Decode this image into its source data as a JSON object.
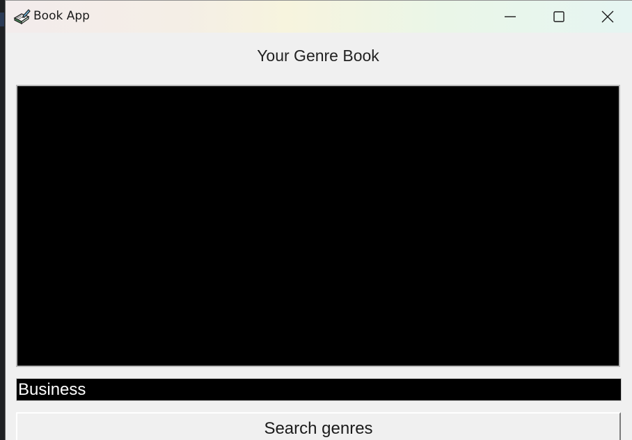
{
  "window": {
    "title": "Book App",
    "icon": "book-with-pen-icon"
  },
  "window_controls": {
    "minimize_icon": "minimize-icon",
    "maximize_icon": "maximize-icon",
    "close_icon": "close-icon"
  },
  "main": {
    "heading": "Your Genre Book",
    "results_box_background": "#000000",
    "genre_input_value": "Business",
    "search_button_label": "Search genres"
  },
  "colors": {
    "window_bg": "#f0f0f0",
    "entry_bg": "#000000",
    "entry_fg": "#ffffff"
  }
}
